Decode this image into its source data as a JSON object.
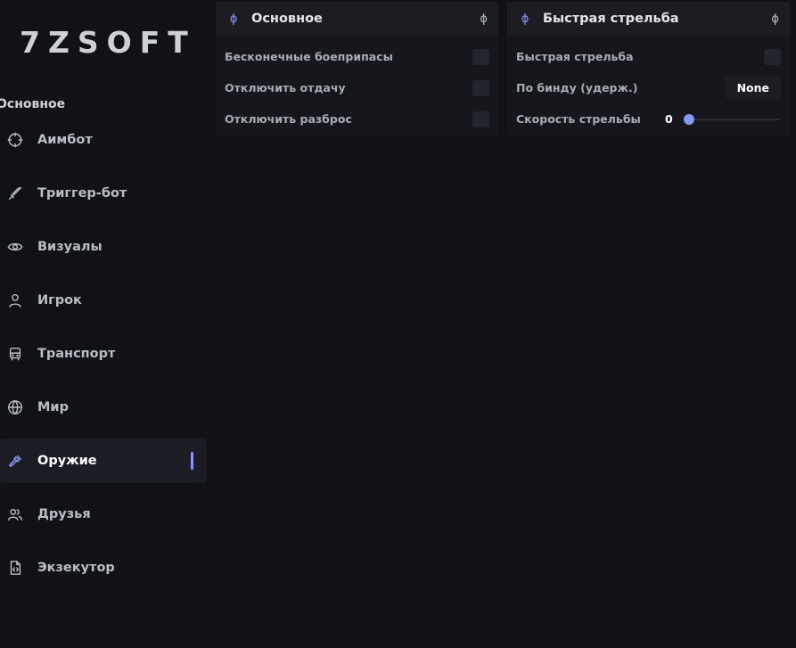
{
  "app": {
    "logo": "7ZSOFT"
  },
  "sidebar": {
    "section_label": "Основное",
    "items": [
      {
        "label": "Аимбот",
        "icon": "crosshair-icon",
        "active": false
      },
      {
        "label": "Триггер-бот",
        "icon": "sword-icon",
        "active": false
      },
      {
        "label": "Визуалы",
        "icon": "eye-icon",
        "active": false
      },
      {
        "label": "Игрок",
        "icon": "user-icon",
        "active": false
      },
      {
        "label": "Транспорт",
        "icon": "bus-icon",
        "active": false
      },
      {
        "label": "Мир",
        "icon": "globe-icon",
        "active": false
      },
      {
        "label": "Оружие",
        "icon": "hammer-icon",
        "active": true
      },
      {
        "label": "Друзья",
        "icon": "users-icon",
        "active": false
      },
      {
        "label": "Экзекутор",
        "icon": "code-file-icon",
        "active": false
      }
    ]
  },
  "panels": {
    "main": {
      "title": "Основное",
      "header_icon": "phi-icon",
      "rows": [
        {
          "label": "Бесконечные боеприпасы",
          "checked": false
        },
        {
          "label": "Отключить отдачу",
          "checked": false
        },
        {
          "label": "Отключить разброс",
          "checked": false
        }
      ]
    },
    "rapid": {
      "title": "Быстрая стрельба",
      "header_icon": "phi-icon",
      "toggle_label": "Быстрая стрельба",
      "toggle_checked": false,
      "bind_label": "По бинду (удерж.)",
      "bind_value": "None",
      "speed_label": "Скорость стрельбы",
      "speed_value": "0",
      "speed_fraction": 0
    }
  },
  "colors": {
    "accent": "#8a96f5",
    "background": "#111216",
    "panel": "#15171c"
  }
}
